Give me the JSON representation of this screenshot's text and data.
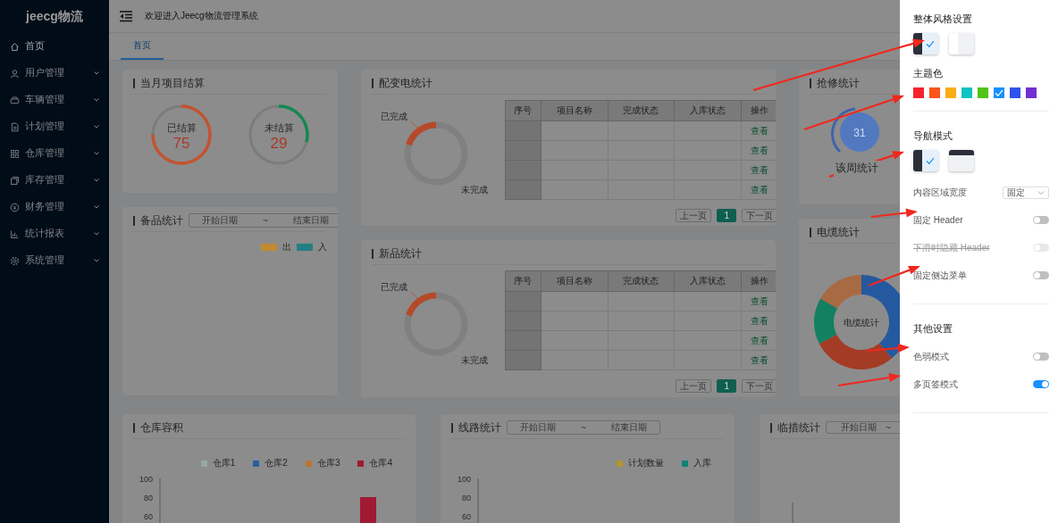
{
  "sidebar": {
    "logo": "jeecg物流",
    "items": [
      {
        "label": "首页",
        "selected": true,
        "expandable": false
      },
      {
        "label": "用户管理",
        "selected": false,
        "expandable": true
      },
      {
        "label": "车辆管理",
        "selected": false,
        "expandable": true
      },
      {
        "label": "计划管理",
        "selected": false,
        "expandable": true
      },
      {
        "label": "仓库管理",
        "selected": false,
        "expandable": true
      },
      {
        "label": "库存管理",
        "selected": false,
        "expandable": true
      },
      {
        "label": "财务管理",
        "selected": false,
        "expandable": true
      },
      {
        "label": "统计报表",
        "selected": false,
        "expandable": true
      },
      {
        "label": "系统管理",
        "selected": false,
        "expandable": true
      }
    ]
  },
  "header": {
    "welcome": "欢迎进入Jeecg物流管理系统"
  },
  "tabs": [
    {
      "label": "首页",
      "selected": true
    }
  ],
  "settlement": {
    "title": "当月项目结算",
    "gauges": [
      {
        "label": "已结算",
        "value": "75",
        "level": 0.75,
        "color": "#c4532f"
      },
      {
        "label": "未结算",
        "value": "29",
        "level": 0.29,
        "color": "#13894f"
      }
    ]
  },
  "spares": {
    "title": "备品统计",
    "date_range": {
      "start_placeholder": "开始日期",
      "separator": "~",
      "end_placeholder": "结束日期"
    },
    "legend": [
      {
        "label": "出",
        "color": "#c08a30"
      },
      {
        "label": "入",
        "color": "#237f82"
      }
    ]
  },
  "distribution": {
    "title": "配变电统计",
    "donut": {
      "done_label": "已完成",
      "todo_label": "未完成",
      "level": 0.2
    },
    "table": {
      "columns": [
        "序号",
        "项目名称",
        "完成状态",
        "入库状态",
        "操作"
      ],
      "rows": [
        {
          "action": "查看"
        },
        {
          "action": "查看"
        },
        {
          "action": "查看"
        },
        {
          "action": "查看"
        }
      ]
    },
    "pagination": {
      "prev": "上一页",
      "pages": [
        {
          "label": "1",
          "selected": true
        }
      ],
      "next": "下一页"
    }
  },
  "new_products": {
    "title": "新品统计",
    "donut": {
      "done_label": "已完成",
      "todo_label": "未完成",
      "level": 0.2
    },
    "table": {
      "columns": [
        "序号",
        "项目名称",
        "完成状态",
        "入库状态",
        "操作"
      ],
      "rows": [
        {
          "action": "查看"
        },
        {
          "action": "查看"
        },
        {
          "action": "查看"
        },
        {
          "action": "查看"
        }
      ]
    },
    "pagination": {
      "prev": "上一页",
      "pages": [
        {
          "label": "1",
          "selected": true
        }
      ],
      "next": "下一页"
    }
  },
  "repair": {
    "title": "抢修统计",
    "value": "31",
    "caption": "该周统计"
  },
  "cable": {
    "title": "电缆统计",
    "center_label": "电缆统计"
  },
  "warehouse": {
    "title": "仓库容积",
    "legend": [
      {
        "label": "仓库1",
        "color": "#9aa6a8"
      },
      {
        "label": "仓库2",
        "color": "#2a5d9e"
      },
      {
        "label": "仓库3",
        "color": "#b87434"
      },
      {
        "label": "仓库4",
        "color": "#a01a32"
      }
    ],
    "y_axis_labels": [
      "100",
      "80",
      "60"
    ]
  },
  "lines": {
    "title": "线路统计",
    "date_range": {
      "start_placeholder": "开始日期",
      "separator": "~",
      "end_placeholder": "结束日期"
    },
    "legend": [
      {
        "label": "计划数量",
        "color": "#b39530"
      },
      {
        "label": "入库",
        "color": "#138178"
      }
    ],
    "y_axis_labels": [
      "100",
      "80",
      "60"
    ]
  },
  "temp": {
    "title": "临措统计",
    "date_range": {
      "start_placeholder": "开始日期",
      "separator": "~"
    }
  },
  "settings_drawer": {
    "style_title": "整体风格设置",
    "style_options": [
      {
        "kind": "dark",
        "selected": true
      },
      {
        "kind": "light",
        "selected": false
      }
    ],
    "theme_title": "主题色",
    "theme_colors": [
      {
        "color": "#f5222d",
        "selected": false
      },
      {
        "color": "#fa541c",
        "selected": false
      },
      {
        "color": "#faad14",
        "selected": false
      },
      {
        "color": "#13c2c2",
        "selected": false
      },
      {
        "color": "#52c41a",
        "selected": false
      },
      {
        "color": "#1890ff",
        "selected": true
      },
      {
        "color": "#2f54eb",
        "selected": false
      },
      {
        "color": "#722ed1",
        "selected": false
      }
    ],
    "nav_title": "导航模式",
    "nav_options": [
      {
        "kind": "side",
        "selected": true
      },
      {
        "kind": "top",
        "selected": false
      }
    ],
    "content_width": {
      "label": "内容区域宽度",
      "value": "固定"
    },
    "layout_toggles": [
      {
        "label": "固定 Header",
        "on": false,
        "disabled": false
      },
      {
        "label": "下滑时隐藏 Header",
        "on": false,
        "disabled": true
      },
      {
        "label": "固定侧边菜单",
        "on": false,
        "disabled": false
      }
    ],
    "other_title": "其他设置",
    "other_toggles": [
      {
        "label": "色弱模式",
        "on": false,
        "disabled": false
      },
      {
        "label": "多页签模式",
        "on": true,
        "disabled": false
      }
    ]
  },
  "annotation_arrows": [
    {
      "kind": "arrow"
    },
    {
      "kind": "arrow"
    },
    {
      "kind": "arrow"
    },
    {
      "kind": "arrow"
    },
    {
      "kind": "arrow"
    },
    {
      "kind": "arrow"
    },
    {
      "kind": "arrow"
    }
  ]
}
